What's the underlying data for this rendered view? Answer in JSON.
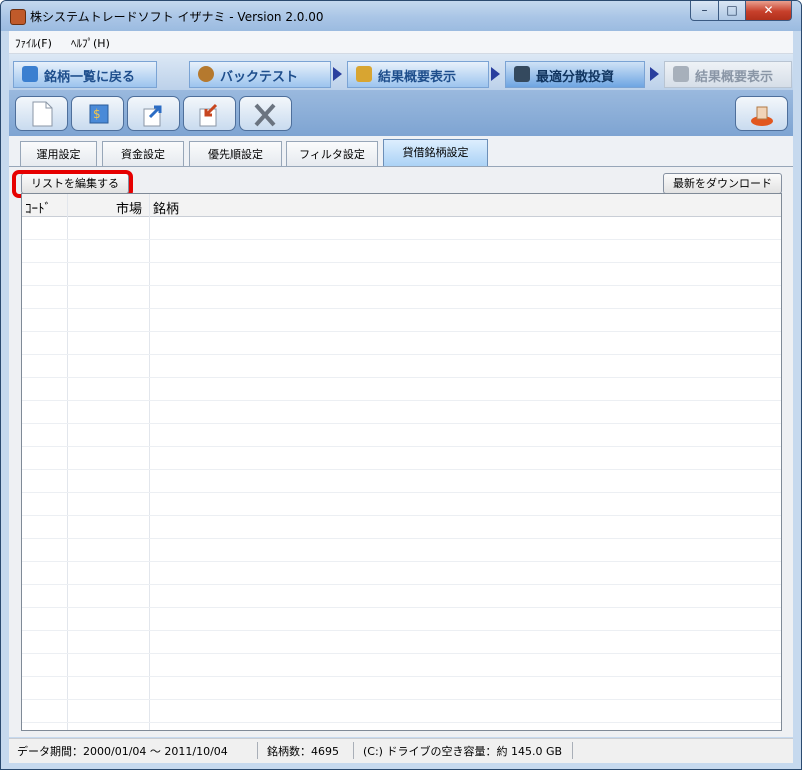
{
  "window": {
    "title": "株システムトレードソフト イザナミ - Version 2.0.00"
  },
  "window_controls": {
    "minimize": "–",
    "maximize": "□",
    "close": "✕"
  },
  "menu": {
    "items": [
      {
        "label": "ﾌｧｲﾙ(F)"
      },
      {
        "label": "ﾍﾙﾌﾟ(H)"
      }
    ]
  },
  "nav": {
    "tabs": [
      {
        "label": "銘柄一覧に戻る",
        "icon": "eye-icon"
      },
      {
        "label": "バックテスト",
        "icon": "money-bag-icon"
      },
      {
        "label": "結果概要表示",
        "icon": "coins-icon"
      },
      {
        "label": "最適分散投資",
        "icon": "grid-icon",
        "active": true
      },
      {
        "label": "結果概要表示",
        "icon": "chart-icon",
        "disabled": true
      }
    ]
  },
  "toolbar": {
    "buttons": [
      "new-document-icon",
      "money-exchange-icon",
      "export-icon",
      "import-icon",
      "settings-tools-icon",
      "stamp-icon"
    ]
  },
  "subtabs": [
    {
      "label": "運用設定"
    },
    {
      "label": "資金設定"
    },
    {
      "label": "優先順設定"
    },
    {
      "label": "フィルタ設定"
    },
    {
      "label": "貸借銘柄設定",
      "active": true
    }
  ],
  "content": {
    "edit_list_label": "リストを編集する",
    "download_label": "最新をダウンロード",
    "columns": [
      "ｺｰﾄﾞ",
      "市場",
      "銘柄"
    ],
    "rows": []
  },
  "status": {
    "data_period": "データ期間：2000/01/04 〜 2011/10/04",
    "stock_count": "銘柄数：4695",
    "free_space": "(C:) ドライブの空き容量：約 145.0 GB"
  },
  "colors": {
    "accent": "#1e4e8c",
    "highlight": "#e60000"
  }
}
